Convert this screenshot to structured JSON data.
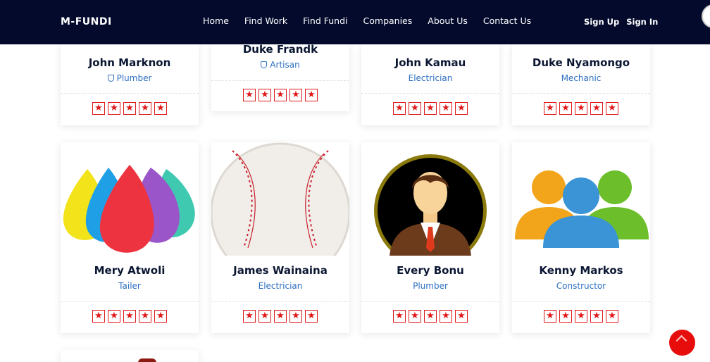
{
  "navbar": {
    "brand": "M-FUNDI",
    "links": [
      "Home",
      "Find Work",
      "Find Fundi",
      "Companies",
      "About Us",
      "Contact Us"
    ],
    "signup": "Sign Up",
    "signin": "Sign In"
  },
  "rating_star": "★",
  "row1": [
    {
      "name": "John Marknon",
      "role": "Plumber",
      "verified": true,
      "rating": 5
    },
    {
      "name": "Duke Frandk",
      "role": "Artisan",
      "verified": true,
      "rating": 5
    },
    {
      "name": "John Kamau",
      "role": "Electrician",
      "verified": false,
      "rating": 5
    },
    {
      "name": "Duke Nyamongo",
      "role": "Mechanic",
      "verified": false,
      "rating": 5
    }
  ],
  "row2": [
    {
      "name": "Mery Atwoli",
      "role": "Tailer",
      "photo": "makeup-sponges",
      "rating": 5
    },
    {
      "name": "James Wainaina",
      "role": "Electrician",
      "photo": "baseball",
      "rating": 5
    },
    {
      "name": "Every Bonu",
      "role": "Plumber",
      "photo": "businessman-avatar",
      "rating": 5
    },
    {
      "name": "Kenny Markos",
      "role": "Constructor",
      "photo": "group-avatar",
      "rating": 5
    }
  ],
  "colors": {
    "navbar": "#030a2c",
    "role_text": "#2d6fc0",
    "star": "#e01919",
    "back_to_top": "#e80d0d"
  }
}
